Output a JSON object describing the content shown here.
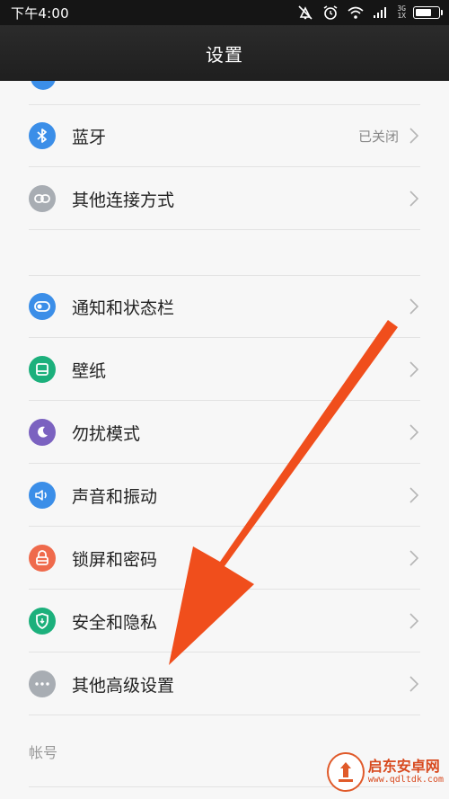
{
  "status_bar": {
    "time": "下午4:00",
    "network_top": "3G",
    "network_bottom": "1X",
    "battery_level": 0.7
  },
  "title_bar": {
    "title": "设置"
  },
  "colors": {
    "bluetooth": "#3b8ee8",
    "other_connection": "#a8adb3",
    "notification": "#3b8ee8",
    "wallpaper": "#1cb07c",
    "dnd": "#7b62c0",
    "sound": "#3b8ee8",
    "lock": "#ef6a4c",
    "security": "#1cb07c",
    "advanced": "#a8adb3",
    "arrow": "#f04e1c"
  },
  "group1": [
    {
      "id": "bluetooth",
      "icon": "bluetooth-icon",
      "label": "蓝牙",
      "value": "已关闭"
    },
    {
      "id": "other-connection",
      "icon": "link-icon",
      "label": "其他连接方式",
      "value": ""
    }
  ],
  "group2": [
    {
      "id": "notification",
      "icon": "toggle-icon",
      "label": "通知和状态栏"
    },
    {
      "id": "wallpaper",
      "icon": "wallpaper-icon",
      "label": "壁纸"
    },
    {
      "id": "dnd",
      "icon": "moon-icon",
      "label": "勿扰模式"
    },
    {
      "id": "sound",
      "icon": "speaker-icon",
      "label": "声音和振动"
    },
    {
      "id": "lock",
      "icon": "lock-icon",
      "label": "锁屏和密码"
    },
    {
      "id": "security",
      "icon": "shield-icon",
      "label": "安全和隐私"
    },
    {
      "id": "advanced",
      "icon": "more-icon",
      "label": "其他高级设置"
    }
  ],
  "section_account": {
    "label": "帐号"
  },
  "watermark": {
    "brand": "启东安卓网",
    "url": "www.qdltdk.com"
  }
}
